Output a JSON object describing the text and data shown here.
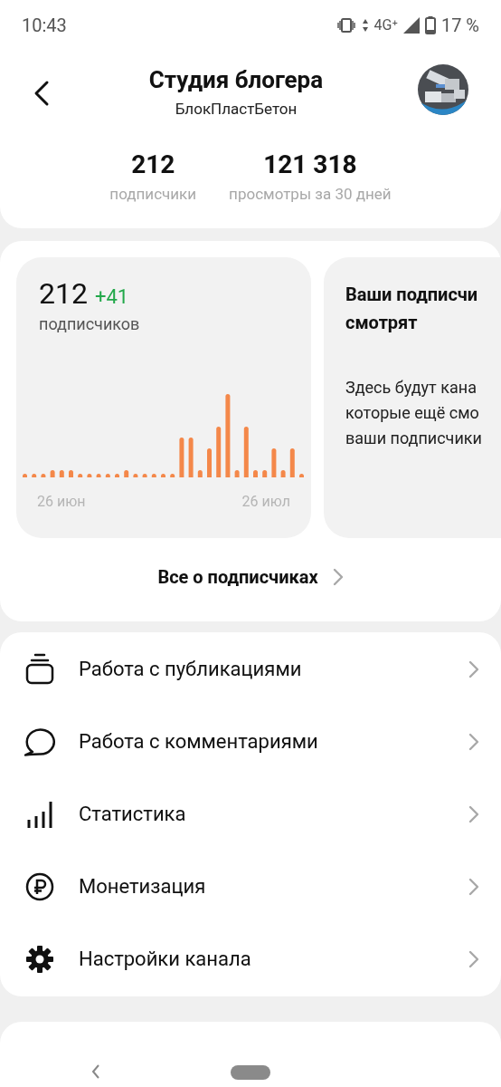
{
  "status_bar": {
    "time": "10:43",
    "network": "4G⁺",
    "battery": "17 %"
  },
  "header": {
    "title": "Студия блогера",
    "subtitle": "БлокПластБетон"
  },
  "stats": [
    {
      "value": "212",
      "label": "подписчики"
    },
    {
      "value": "121 318",
      "label": "просмотры за 30 дней"
    }
  ],
  "cards": [
    {
      "kind": "chart",
      "value": "212",
      "delta": "+41",
      "label": "подписчиков",
      "x_labels": [
        "26 июн",
        "26 июл"
      ]
    },
    {
      "kind": "info",
      "title_lines": [
        "Ваши подписчи",
        "смотрят"
      ],
      "text_lines": [
        "Здесь будут кана",
        "которые ещё смо",
        "ваши подписчики"
      ]
    }
  ],
  "all_link": "Все о подписчиках",
  "menu": [
    {
      "kind": "publications",
      "label": "Работа с публикациями"
    },
    {
      "kind": "comments",
      "label": "Работа с комментариями"
    },
    {
      "kind": "stats",
      "label": "Статистика"
    },
    {
      "kind": "money",
      "label": "Монетизация"
    },
    {
      "kind": "settings",
      "label": "Настройки канала"
    }
  ]
}
